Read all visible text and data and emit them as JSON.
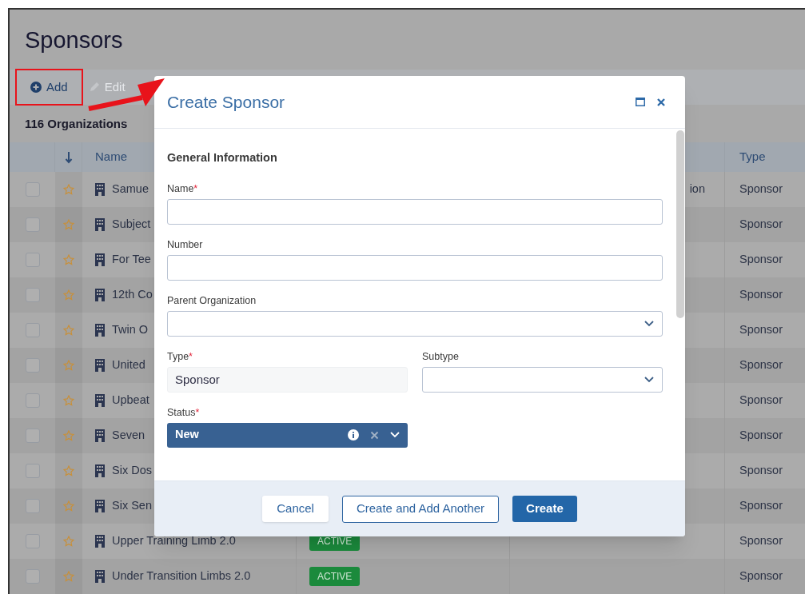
{
  "page": {
    "title": "Sponsors"
  },
  "toolbar": [
    {
      "label": "Add",
      "kind": "add",
      "disabled": false,
      "highlighted": true
    },
    {
      "label": "Edit",
      "kind": "edit",
      "disabled": true,
      "highlighted": false
    }
  ],
  "count": "116 Organizations",
  "table": {
    "columns": [
      {
        "label": "Name"
      },
      {
        "label": "Type"
      }
    ],
    "rows": [
      {
        "checked": false,
        "favorite": false,
        "name": "Samue",
        "column_5": "ion",
        "type": "Sponsor"
      },
      {
        "checked": false,
        "favorite": false,
        "name": "Subject",
        "type": "Sponsor"
      },
      {
        "checked": false,
        "favorite": false,
        "name": "For Tee",
        "type": "Sponsor"
      },
      {
        "checked": false,
        "favorite": false,
        "name": "12th Co",
        "type": "Sponsor"
      },
      {
        "checked": false,
        "favorite": false,
        "name": "Twin O",
        "type": "Sponsor"
      },
      {
        "checked": false,
        "favorite": false,
        "name": "United",
        "type": "Sponsor"
      },
      {
        "checked": false,
        "favorite": false,
        "name": "Upbeat",
        "type": "Sponsor"
      },
      {
        "checked": false,
        "favorite": false,
        "name": "Seven",
        "type": "Sponsor"
      },
      {
        "checked": false,
        "favorite": false,
        "name": "Six Dos",
        "type": "Sponsor"
      },
      {
        "checked": false,
        "favorite": false,
        "name": "Six Sen",
        "type": "Sponsor"
      },
      {
        "checked": false,
        "favorite": false,
        "name": "Upper Training Limb 2.0",
        "status": "ACTIVE",
        "type": "Sponsor"
      },
      {
        "checked": false,
        "favorite": false,
        "name": "Under Transition Limbs 2.0",
        "status": "ACTIVE",
        "type": "Sponsor"
      }
    ]
  },
  "dialog": {
    "title": "Create Sponsor",
    "section": "General Information",
    "field_rows": [
      [
        {
          "label": "Name",
          "required_mark": "*",
          "kind": "text"
        }
      ],
      [
        {
          "label": "Number",
          "kind": "text"
        }
      ],
      [
        {
          "label": "Parent Organization",
          "kind": "select"
        }
      ],
      [
        {
          "label": "Type",
          "required_mark": "*",
          "kind": "readonly",
          "value": "Sponsor"
        },
        {
          "label": "Subtype",
          "kind": "select"
        }
      ],
      [
        {
          "label": "Status",
          "required_mark": "*",
          "kind": "status",
          "value": "New"
        }
      ]
    ],
    "buttons": [
      {
        "label": "Cancel",
        "kind": "secondary"
      },
      {
        "label": "Create and Add Another",
        "kind": "outline"
      },
      {
        "label": "Create",
        "kind": "primary"
      }
    ]
  }
}
